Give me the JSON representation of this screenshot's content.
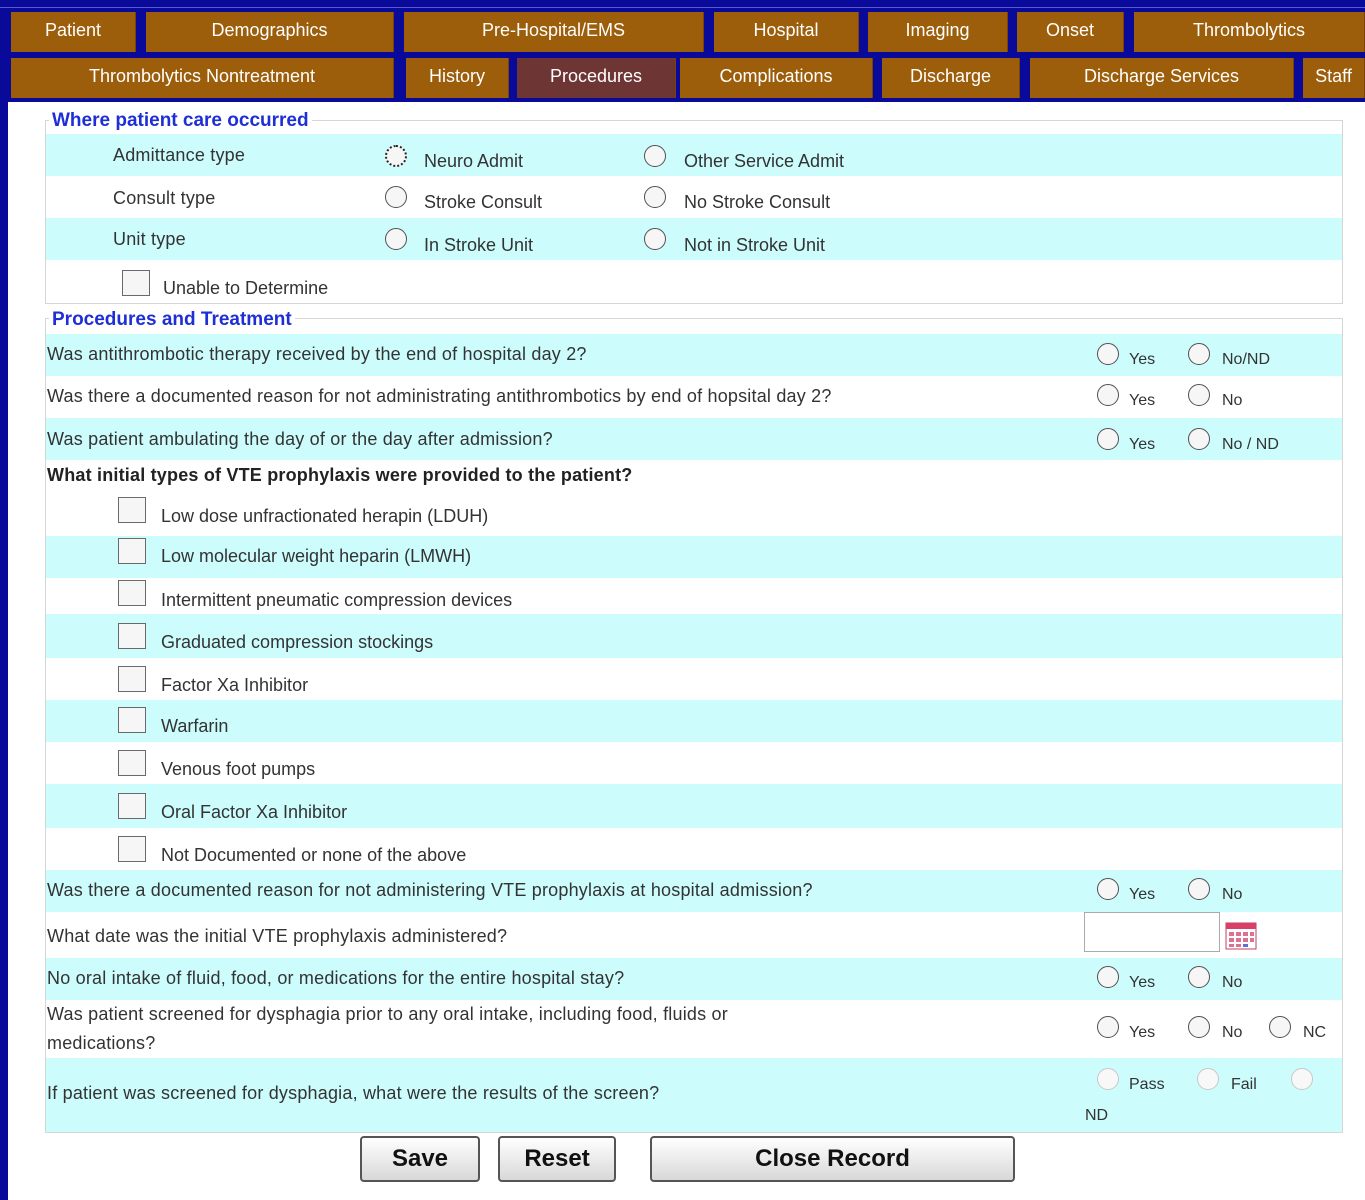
{
  "tabs_row1": [
    "Patient",
    "Demographics",
    "Pre-Hospital/EMS",
    "Hospital",
    "Imaging",
    "Onset",
    "Thrombolytics"
  ],
  "tabs_row2": [
    "Thrombolytics Nontreatment",
    "History",
    "Procedures",
    "Complications",
    "Discharge",
    "Discharge Services",
    "Staff"
  ],
  "active_tab": "Procedures",
  "care": {
    "title": "Where patient care occurred",
    "admittance_label": "Admittance type",
    "admittance_opt1": "Neuro Admit",
    "admittance_opt2": "Other Service Admit",
    "consult_label": "Consult type",
    "consult_opt1": "Stroke Consult",
    "consult_opt2": "No Stroke Consult",
    "unit_label": "Unit type",
    "unit_opt1": "In Stroke Unit",
    "unit_opt2": "Not in Stroke Unit",
    "unable": "Unable to Determine"
  },
  "proc": {
    "title": "Procedures and Treatment",
    "q1": "Was antithrombotic therapy received by the end of hospital day 2?",
    "q1_yes": "Yes",
    "q1_no": "No/ND",
    "q2": "Was there a documented reason for not administrating antithrombotics by end of hopsital day 2?",
    "q2_yes": "Yes",
    "q2_no": "No",
    "q3": "Was patient ambulating the day of or the day after admission?",
    "q3_yes": "Yes",
    "q3_no": "No / ND",
    "vte_q": "What initial types of VTE prophylaxis were provided to the patient?",
    "vte": [
      "Low dose unfractionated herapin (LDUH)",
      "Low molecular weight heparin (LMWH)",
      "Intermittent pneumatic compression devices",
      "Graduated compression stockings",
      "Factor Xa Inhibitor",
      "Warfarin",
      "Venous foot pumps",
      "Oral Factor Xa Inhibitor",
      "Not Documented or none of the above"
    ],
    "q4": "Was there a documented reason for not administering VTE prophylaxis at hospital admission?",
    "q4_yes": "Yes",
    "q4_no": "No",
    "q5": "What date was the initial VTE prophylaxis administered?",
    "q6": "No oral intake of fluid, food, or medications for the entire hospital stay?",
    "q6_yes": "Yes",
    "q6_no": "No",
    "q7a": "Was patient screened for dysphagia prior to any oral intake, including food, fluids or",
    "q7b": "medications?",
    "q7_yes": "Yes",
    "q7_no": "No",
    "q7_nc": "NC",
    "q8": "If patient was screened for dysphagia, what were the results of the screen?",
    "q8_pass": "Pass",
    "q8_fail": "Fail",
    "q8_nd": "ND"
  },
  "buttons": {
    "save": "Save",
    "reset": "Reset",
    "close": "Close Record"
  }
}
